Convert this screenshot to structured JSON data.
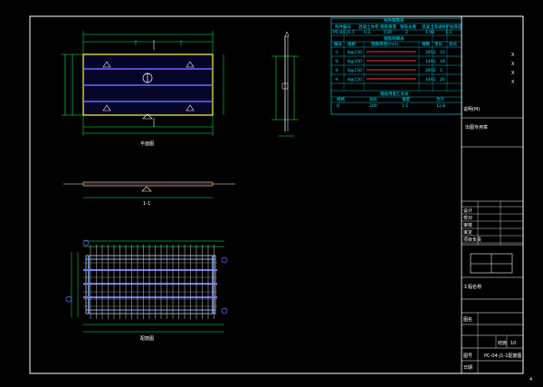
{
  "drawing": {
    "sheet_title": "PC-04-J1-1配筋图",
    "corner_code": "4",
    "design_company_lines": [
      "X",
      "X",
      "X",
      "X"
    ],
    "scale_label": "1-1",
    "plan_label": "平面图",
    "rebar_plan_label": "配筋图"
  },
  "tables": {
    "schedule_title": "构件钢筋表",
    "schedule_header": [
      "构件编号",
      "混凝土体积",
      "钢筋重量",
      "钢筋总重",
      "混凝土等级",
      "保护层厚度"
    ],
    "schedule_row": [
      "PC-04-J1-1",
      "0.3",
      "C30",
      "2",
      "1.08",
      "1.3"
    ],
    "bar_table_title": "钢筋明细表",
    "bar_header": [
      "编号",
      "规格",
      "钢筋简图(mm)",
      "根数",
      "单长",
      "总长"
    ],
    "bar_rows": [
      {
        "id": "①",
        "spec": "8@150",
        "len": "2952",
        "qty": "15"
      },
      {
        "id": "②",
        "spec": "8@200",
        "len": "1492",
        "qty": "18"
      },
      {
        "id": "③",
        "spec": "8@150",
        "len": "2952",
        "qty": "5"
      },
      {
        "id": "④",
        "spec": "8@150",
        "len": "1492",
        "qty": "20"
      }
    ],
    "summary_title": "钢筋用量汇总表",
    "summary_header": [
      "规格",
      "总长",
      "重量",
      "合计"
    ],
    "summary_row": [
      "8",
      "200",
      "1.5",
      "12.8"
    ],
    "note": "说明(M)"
  },
  "title_block": {
    "stamp_label": "出图专用章",
    "rows": [
      "设计",
      "校对",
      "审核",
      "审定",
      "项目负责",
      "专业负责"
    ],
    "project_label": "工程名称",
    "drawing_name_label": "图名",
    "drawing_no_label": "图号",
    "date_label": "日期",
    "sheet_label": "结施",
    "sheet_no": "10"
  }
}
